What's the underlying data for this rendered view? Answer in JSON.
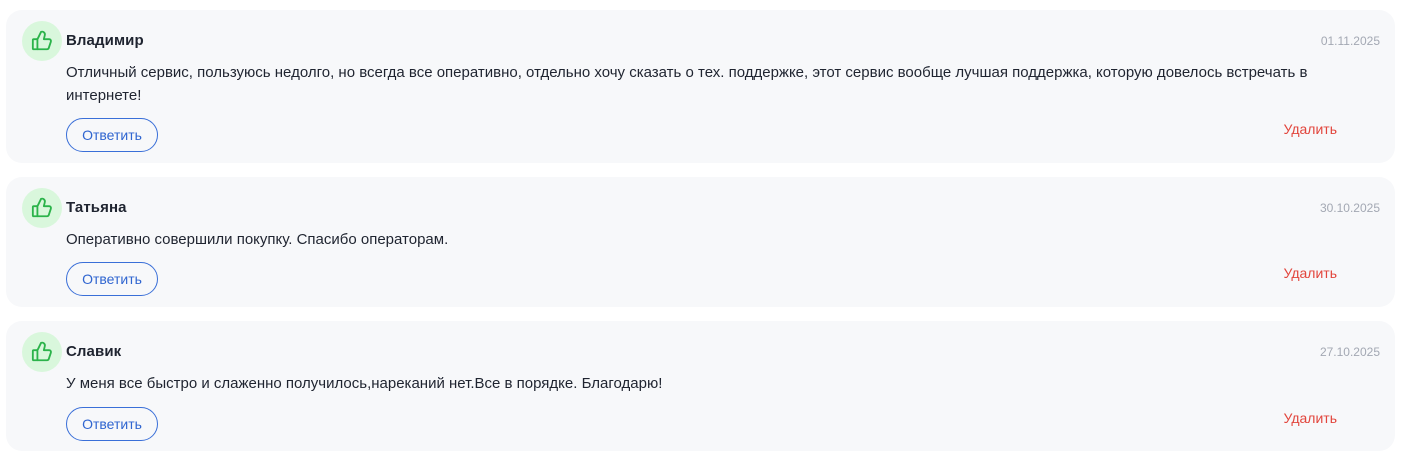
{
  "reviews": [
    {
      "author": "Владимир",
      "date": "01.11.2025",
      "text": "Отличный сервис, пользуюсь недолго, но всегда все оперативно, отдельно хочу сказать о тех. поддержке, этот сервис вообще лучшая поддержка, которую довелось встречать в интернете!",
      "reply_label": "Ответить",
      "delete_label": "Удалить",
      "icon": "thumbs-up-icon"
    },
    {
      "author": "Татьяна",
      "date": "30.10.2025",
      "text": "Оперативно совершили покупку. Спасибо операторам.",
      "reply_label": "Ответить",
      "delete_label": "Удалить",
      "icon": "thumbs-up-icon"
    },
    {
      "author": "Славик",
      "date": "27.10.2025",
      "text": "У меня все быстро и слаженно получилось,нареканий нет.Все в порядке. Благодарю!",
      "reply_label": "Ответить",
      "delete_label": "Удалить",
      "icon": "thumbs-up-icon"
    }
  ],
  "colors": {
    "card_background": "#f7f8fa",
    "avatar_background": "#d9f7dc",
    "thumb_icon": "#2bb34a",
    "reply_accent": "#2f65d0",
    "delete_accent": "#e2453c",
    "date_text": "#a3a8b3"
  }
}
